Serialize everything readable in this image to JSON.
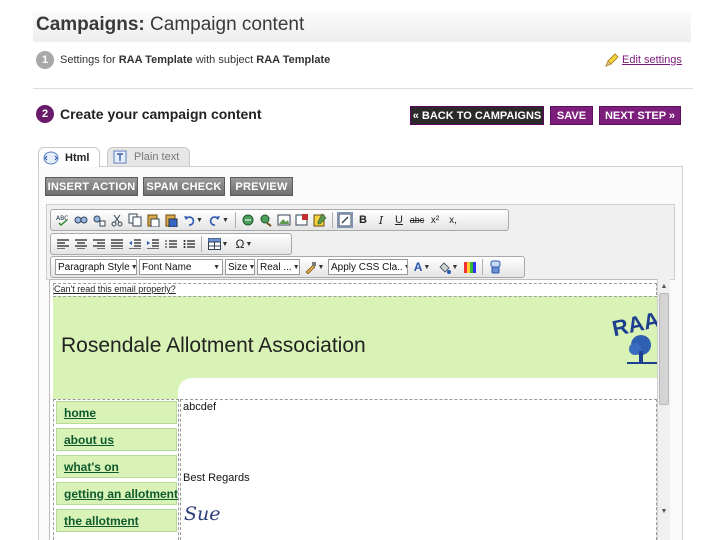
{
  "header": {
    "title_bold": "Campaigns:",
    "title_rest": " Campaign content"
  },
  "step1": {
    "number": "1",
    "text_pre": "Settings for ",
    "template_bold": "RAA Template",
    "text_mid": " with subject ",
    "subject_bold": "RAA Template",
    "edit_label": "Edit settings"
  },
  "step2": {
    "number": "2",
    "title": "Create your campaign content",
    "back_label": "« BACK TO CAMPAIGNS",
    "save_label": "SAVE",
    "next_label": "NEXT STEP »"
  },
  "tabs": [
    {
      "label": "Html"
    },
    {
      "label": "Plain text"
    }
  ],
  "actions": {
    "insert_label": "INSERT ACTION",
    "spam_label": "SPAM CHECK",
    "preview_label": "PREVIEW"
  },
  "toolbar": {
    "bold": "B",
    "italic": "I",
    "underline": "U",
    "strike": "abc",
    "superscript": "x²",
    "subscript": "x,",
    "paragraph_style": "Paragraph Style",
    "font_name": "Font Name",
    "size": "Size",
    "real": "Real ...",
    "css_class": "Apply CSS Cla..",
    "font_color_letter": "A",
    "omega": "Ω"
  },
  "email": {
    "cant_read": "Can't read this email properly?",
    "association_name": "Rosendale Allotment Association",
    "logo_text": "RAA",
    "nav": [
      "home",
      "about us",
      "what's on",
      "getting an allotment",
      "the allotment"
    ],
    "body_line1": "abcdef",
    "body_line2": "Best Regards",
    "signature": "Sue"
  },
  "colors": {
    "brand_purple": "#7d1e7d",
    "banner_green": "#d9f3b7",
    "nav_text": "#0e5a2e"
  }
}
